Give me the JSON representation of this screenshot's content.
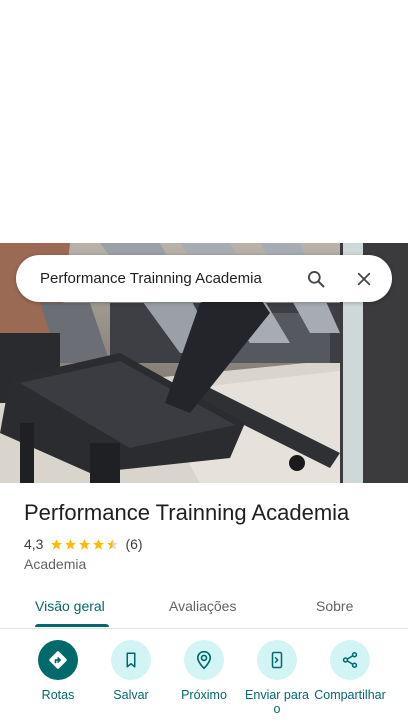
{
  "search": {
    "query": "Performance Trainning Academia"
  },
  "place": {
    "title": "Performance Trainning Academia",
    "rating": "4,3",
    "stars": 4.3,
    "review_count": "(6)",
    "category": "Academia"
  },
  "tabs": [
    {
      "label": "Visão geral",
      "active": true
    },
    {
      "label": "Avaliações",
      "active": false
    },
    {
      "label": "Sobre",
      "active": false
    }
  ],
  "actions": [
    {
      "label": "Rotas",
      "icon": "directions-icon"
    },
    {
      "label": "Salvar",
      "icon": "bookmark-icon"
    },
    {
      "label": "Próximo",
      "icon": "nearby-icon"
    },
    {
      "label": "Enviar para o",
      "icon": "send-to-phone-icon"
    },
    {
      "label": "Compartilhar",
      "icon": "share-icon"
    }
  ],
  "colors": {
    "accent": "#00696b",
    "accent_light": "#d2f4f5",
    "star": "#fbbc04"
  }
}
